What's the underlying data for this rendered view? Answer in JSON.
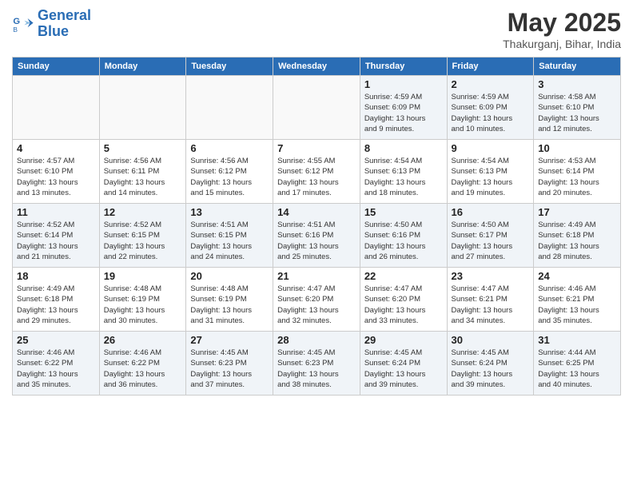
{
  "header": {
    "logo_line1": "General",
    "logo_line2": "Blue",
    "title": "May 2025",
    "subtitle": "Thakurganj, Bihar, India"
  },
  "columns": [
    "Sunday",
    "Monday",
    "Tuesday",
    "Wednesday",
    "Thursday",
    "Friday",
    "Saturday"
  ],
  "weeks": [
    [
      {
        "day": "",
        "info": ""
      },
      {
        "day": "",
        "info": ""
      },
      {
        "day": "",
        "info": ""
      },
      {
        "day": "",
        "info": ""
      },
      {
        "day": "1",
        "info": "Sunrise: 4:59 AM\nSunset: 6:09 PM\nDaylight: 13 hours\nand 9 minutes."
      },
      {
        "day": "2",
        "info": "Sunrise: 4:59 AM\nSunset: 6:09 PM\nDaylight: 13 hours\nand 10 minutes."
      },
      {
        "day": "3",
        "info": "Sunrise: 4:58 AM\nSunset: 6:10 PM\nDaylight: 13 hours\nand 12 minutes."
      }
    ],
    [
      {
        "day": "4",
        "info": "Sunrise: 4:57 AM\nSunset: 6:10 PM\nDaylight: 13 hours\nand 13 minutes."
      },
      {
        "day": "5",
        "info": "Sunrise: 4:56 AM\nSunset: 6:11 PM\nDaylight: 13 hours\nand 14 minutes."
      },
      {
        "day": "6",
        "info": "Sunrise: 4:56 AM\nSunset: 6:12 PM\nDaylight: 13 hours\nand 15 minutes."
      },
      {
        "day": "7",
        "info": "Sunrise: 4:55 AM\nSunset: 6:12 PM\nDaylight: 13 hours\nand 17 minutes."
      },
      {
        "day": "8",
        "info": "Sunrise: 4:54 AM\nSunset: 6:13 PM\nDaylight: 13 hours\nand 18 minutes."
      },
      {
        "day": "9",
        "info": "Sunrise: 4:54 AM\nSunset: 6:13 PM\nDaylight: 13 hours\nand 19 minutes."
      },
      {
        "day": "10",
        "info": "Sunrise: 4:53 AM\nSunset: 6:14 PM\nDaylight: 13 hours\nand 20 minutes."
      }
    ],
    [
      {
        "day": "11",
        "info": "Sunrise: 4:52 AM\nSunset: 6:14 PM\nDaylight: 13 hours\nand 21 minutes."
      },
      {
        "day": "12",
        "info": "Sunrise: 4:52 AM\nSunset: 6:15 PM\nDaylight: 13 hours\nand 22 minutes."
      },
      {
        "day": "13",
        "info": "Sunrise: 4:51 AM\nSunset: 6:15 PM\nDaylight: 13 hours\nand 24 minutes."
      },
      {
        "day": "14",
        "info": "Sunrise: 4:51 AM\nSunset: 6:16 PM\nDaylight: 13 hours\nand 25 minutes."
      },
      {
        "day": "15",
        "info": "Sunrise: 4:50 AM\nSunset: 6:16 PM\nDaylight: 13 hours\nand 26 minutes."
      },
      {
        "day": "16",
        "info": "Sunrise: 4:50 AM\nSunset: 6:17 PM\nDaylight: 13 hours\nand 27 minutes."
      },
      {
        "day": "17",
        "info": "Sunrise: 4:49 AM\nSunset: 6:18 PM\nDaylight: 13 hours\nand 28 minutes."
      }
    ],
    [
      {
        "day": "18",
        "info": "Sunrise: 4:49 AM\nSunset: 6:18 PM\nDaylight: 13 hours\nand 29 minutes."
      },
      {
        "day": "19",
        "info": "Sunrise: 4:48 AM\nSunset: 6:19 PM\nDaylight: 13 hours\nand 30 minutes."
      },
      {
        "day": "20",
        "info": "Sunrise: 4:48 AM\nSunset: 6:19 PM\nDaylight: 13 hours\nand 31 minutes."
      },
      {
        "day": "21",
        "info": "Sunrise: 4:47 AM\nSunset: 6:20 PM\nDaylight: 13 hours\nand 32 minutes."
      },
      {
        "day": "22",
        "info": "Sunrise: 4:47 AM\nSunset: 6:20 PM\nDaylight: 13 hours\nand 33 minutes."
      },
      {
        "day": "23",
        "info": "Sunrise: 4:47 AM\nSunset: 6:21 PM\nDaylight: 13 hours\nand 34 minutes."
      },
      {
        "day": "24",
        "info": "Sunrise: 4:46 AM\nSunset: 6:21 PM\nDaylight: 13 hours\nand 35 minutes."
      }
    ],
    [
      {
        "day": "25",
        "info": "Sunrise: 4:46 AM\nSunset: 6:22 PM\nDaylight: 13 hours\nand 35 minutes."
      },
      {
        "day": "26",
        "info": "Sunrise: 4:46 AM\nSunset: 6:22 PM\nDaylight: 13 hours\nand 36 minutes."
      },
      {
        "day": "27",
        "info": "Sunrise: 4:45 AM\nSunset: 6:23 PM\nDaylight: 13 hours\nand 37 minutes."
      },
      {
        "day": "28",
        "info": "Sunrise: 4:45 AM\nSunset: 6:23 PM\nDaylight: 13 hours\nand 38 minutes."
      },
      {
        "day": "29",
        "info": "Sunrise: 4:45 AM\nSunset: 6:24 PM\nDaylight: 13 hours\nand 39 minutes."
      },
      {
        "day": "30",
        "info": "Sunrise: 4:45 AM\nSunset: 6:24 PM\nDaylight: 13 hours\nand 39 minutes."
      },
      {
        "day": "31",
        "info": "Sunrise: 4:44 AM\nSunset: 6:25 PM\nDaylight: 13 hours\nand 40 minutes."
      }
    ]
  ]
}
